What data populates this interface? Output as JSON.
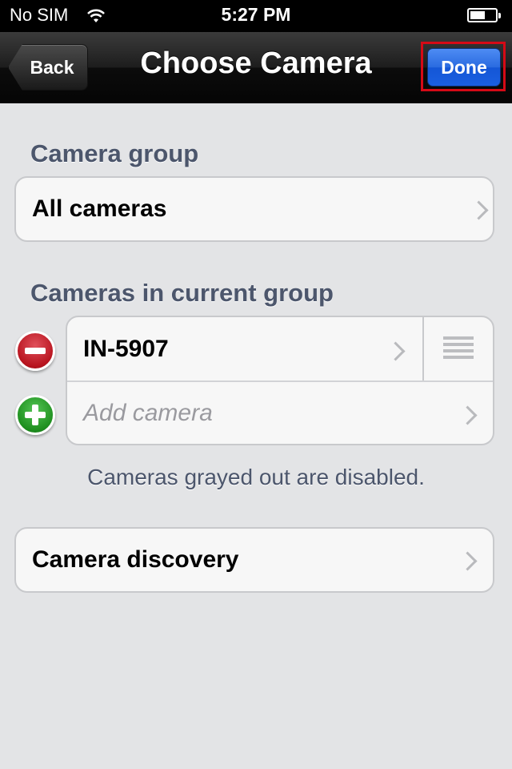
{
  "status_bar": {
    "carrier": "No SIM",
    "time": "5:27 PM"
  },
  "nav": {
    "back_label": "Back",
    "title": "Choose Camera",
    "done_label": "Done"
  },
  "camera_group": {
    "header": "Camera group",
    "value": "All cameras"
  },
  "current_group": {
    "header": "Cameras in current group",
    "cameras": [
      {
        "name": "IN-5907"
      }
    ],
    "add_placeholder": "Add camera",
    "note": "Cameras grayed out are disabled."
  },
  "discovery": {
    "label": "Camera discovery"
  },
  "colors": {
    "accent": "#1a5fe0",
    "highlight_border": "#d50a16",
    "delete": "#b8141f",
    "add": "#1e8f1f"
  },
  "icons": [
    "wifi-icon",
    "battery-icon",
    "chevron-right-icon",
    "delete-icon",
    "add-icon",
    "reorder-icon"
  ]
}
